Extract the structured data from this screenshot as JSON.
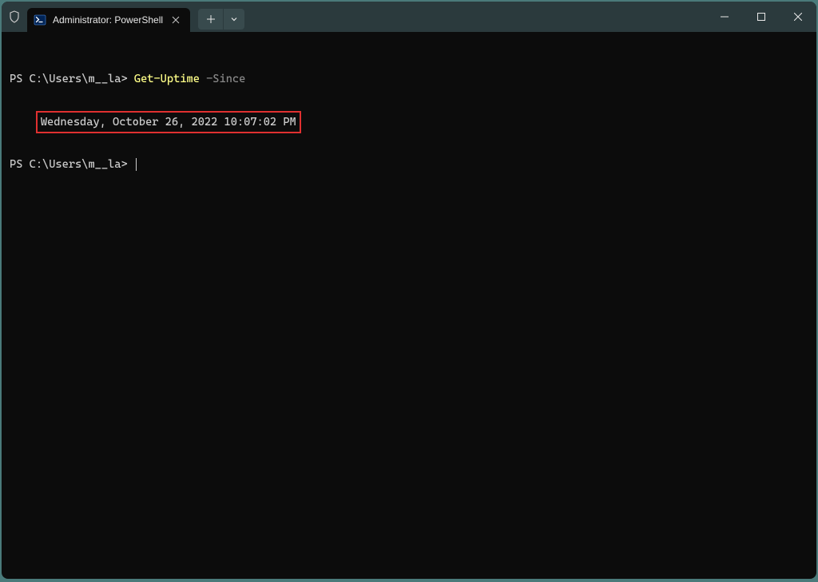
{
  "titlebar": {
    "tab_title": "Administrator: PowerShell"
  },
  "terminal": {
    "prompt1": "PS C:\\Users\\m__la> ",
    "cmd": "Get-Uptime",
    "param": " -Since",
    "output": "Wednesday, October 26, 2022 10:07:02 PM",
    "prompt2": "PS C:\\Users\\m__la> "
  }
}
